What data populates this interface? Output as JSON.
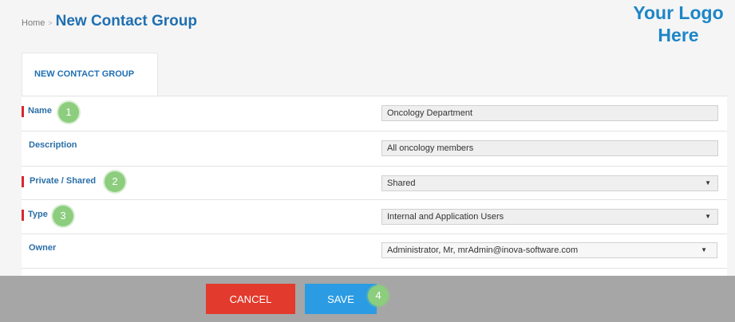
{
  "breadcrumb": {
    "home": "Home",
    "separator": ">",
    "title": "New Contact Group"
  },
  "logo": {
    "line1": "Your Logo",
    "line2": "Here"
  },
  "tab": {
    "label": "NEW CONTACT GROUP"
  },
  "form": {
    "name": {
      "label": "Name",
      "value": "Oncology Department",
      "required": true
    },
    "description": {
      "label": "Description",
      "value": "All oncology members",
      "required": false
    },
    "private_shared": {
      "label": "Private / Shared",
      "value": "Shared",
      "required": true
    },
    "type": {
      "label": "Type",
      "value": "Internal and Application Users",
      "required": true
    },
    "owner": {
      "label": "Owner",
      "value": "Administrator, Mr, mrAdmin@inova-software.com",
      "required": false
    }
  },
  "badges": [
    "1",
    "2",
    "3",
    "4"
  ],
  "icons": {
    "dropdown": "▼"
  },
  "footer": {
    "cancel": "CANCEL",
    "save": "SAVE"
  },
  "colors": {
    "brand_blue": "#1f6fb2",
    "required_marker": "#d9272e",
    "cancel_button": "#e23a2c",
    "save_button": "#2b9be3",
    "badge": "#8ccd7e"
  }
}
